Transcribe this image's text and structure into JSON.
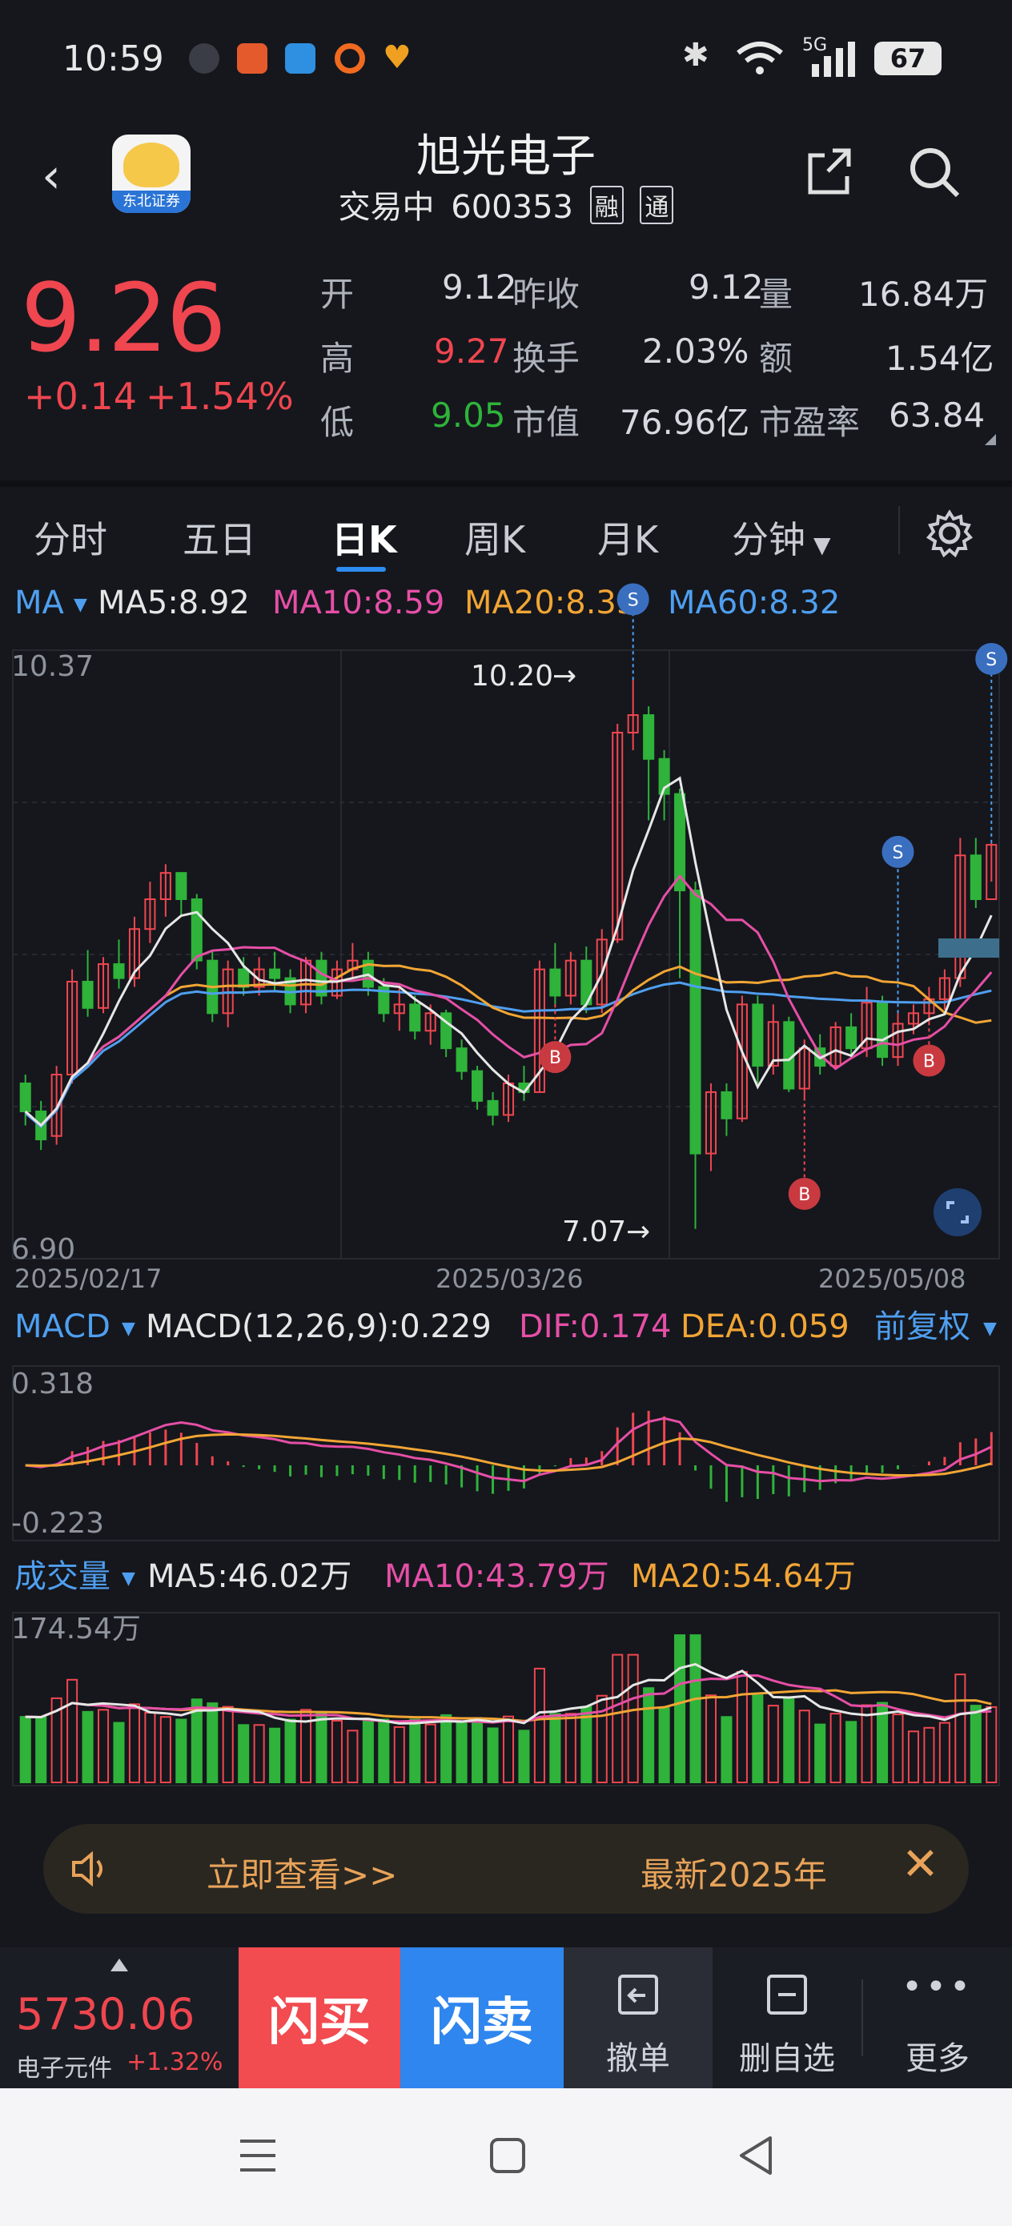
{
  "status_bar": {
    "time": "10:59",
    "battery": "67",
    "network": "5G"
  },
  "header": {
    "title": "旭光电子",
    "status": "交易中",
    "code": "600353",
    "tag_margin": "融",
    "tag_connect": "通",
    "logo_text": "东北证券"
  },
  "quote": {
    "price": "9.26",
    "change": "+0.14",
    "change_pct": "+1.54%",
    "open_label": "开",
    "open": "9.12",
    "prev_close_label": "昨收",
    "prev_close": "9.12",
    "volume_label": "量",
    "volume": "16.84万",
    "high_label": "高",
    "high": "9.27",
    "turnover_label": "换手",
    "turnover": "2.03%",
    "amount_label": "额",
    "amount": "1.54亿",
    "low_label": "低",
    "low": "9.05",
    "mktcap_label": "市值",
    "mktcap": "76.96亿",
    "pe_label": "市盈率",
    "pe": "63.84"
  },
  "tabs": [
    {
      "label": "分时"
    },
    {
      "label": "五日"
    },
    {
      "label": "日K"
    },
    {
      "label": "周K"
    },
    {
      "label": "月K"
    },
    {
      "label": "分钟"
    }
  ],
  "ma_legend": {
    "name": "MA",
    "ma5": "MA5:8.92",
    "ma10": "MA10:8.59",
    "ma20": "MA20:8.33",
    "ma60": "MA60:8.32"
  },
  "macd_legend": {
    "name": "MACD",
    "macd": "MACD(12,26,9):0.229",
    "dif": "DIF:0.174",
    "dea": "DEA:0.059",
    "adjust": "前复权"
  },
  "vol_legend": {
    "name": "成交量",
    "ma5": "MA5:46.02万",
    "ma10": "MA10:43.79万",
    "ma20": "MA20:54.64万"
  },
  "colors": {
    "up": "#f0464f",
    "down": "#2fb33a",
    "ma5": "#e6e6e6",
    "ma10": "#e64fa6",
    "ma20": "#f2a534",
    "ma60": "#4f9ff0",
    "accent": "#2d8cf0"
  },
  "chart_data": [
    {
      "type": "candlestick",
      "title": "",
      "x_labels": [
        "2025/02/17",
        "2025/03/26",
        "2025/05/08"
      ],
      "ylim": [
        6.9,
        10.37
      ],
      "y_labels": [
        "10.37",
        "6.90"
      ],
      "annotations": [
        {
          "label": "10.20",
          "kind": "high"
        },
        {
          "label": "7.07",
          "kind": "low"
        }
      ],
      "markers": [
        {
          "label": "S"
        },
        {
          "label": "S"
        },
        {
          "label": "S"
        },
        {
          "label": "B"
        },
        {
          "label": "B"
        },
        {
          "label": "B"
        }
      ],
      "candles": [
        [
          7.9,
          7.74,
          7.95,
          7.66
        ],
        [
          7.74,
          7.58,
          7.8,
          7.52
        ],
        [
          7.6,
          7.95,
          8.0,
          7.55
        ],
        [
          7.95,
          8.48,
          8.55,
          7.9
        ],
        [
          8.48,
          8.33,
          8.66,
          8.28
        ],
        [
          8.33,
          8.58,
          8.62,
          8.3
        ],
        [
          8.58,
          8.5,
          8.72,
          8.44
        ],
        [
          8.5,
          8.78,
          8.85,
          8.45
        ],
        [
          8.78,
          8.95,
          9.05,
          8.7
        ],
        [
          8.95,
          9.1,
          9.15,
          8.85
        ],
        [
          9.1,
          8.95,
          9.1,
          8.85
        ],
        [
          8.95,
          8.6,
          8.98,
          8.55
        ],
        [
          8.6,
          8.3,
          8.65,
          8.25
        ],
        [
          8.3,
          8.55,
          8.6,
          8.22
        ],
        [
          8.55,
          8.45,
          8.62,
          8.4
        ],
        [
          8.45,
          8.55,
          8.62,
          8.4
        ],
        [
          8.55,
          8.5,
          8.65,
          8.42
        ],
        [
          8.5,
          8.35,
          8.55,
          8.3
        ],
        [
          8.35,
          8.6,
          8.62,
          8.3
        ],
        [
          8.6,
          8.4,
          8.65,
          8.35
        ],
        [
          8.4,
          8.55,
          8.6,
          8.38
        ],
        [
          8.55,
          8.6,
          8.7,
          8.5
        ],
        [
          8.6,
          8.45,
          8.65,
          8.4
        ],
        [
          8.45,
          8.3,
          8.5,
          8.25
        ],
        [
          8.3,
          8.35,
          8.45,
          8.2
        ],
        [
          8.35,
          8.2,
          8.4,
          8.15
        ],
        [
          8.2,
          8.3,
          8.35,
          8.12
        ],
        [
          8.3,
          8.1,
          8.32,
          8.05
        ],
        [
          8.1,
          7.97,
          8.15,
          7.92
        ],
        [
          7.97,
          7.8,
          8.0,
          7.75
        ],
        [
          7.8,
          7.72,
          7.85,
          7.66
        ],
        [
          7.72,
          7.9,
          7.95,
          7.68
        ],
        [
          7.9,
          7.85,
          8.0,
          7.8
        ],
        [
          7.85,
          8.55,
          8.6,
          7.85
        ],
        [
          8.55,
          8.4,
          8.7,
          8.35
        ],
        [
          8.4,
          8.6,
          8.65,
          8.35
        ],
        [
          8.6,
          8.35,
          8.68,
          8.3
        ],
        [
          8.35,
          8.72,
          8.78,
          8.3
        ],
        [
          8.72,
          9.9,
          9.95,
          8.7
        ],
        [
          9.9,
          10.0,
          10.2,
          9.8
        ],
        [
          10.0,
          9.75,
          10.05,
          9.4
        ],
        [
          9.75,
          9.55,
          9.8,
          9.4
        ],
        [
          9.55,
          9.0,
          9.58,
          8.5
        ],
        [
          9.0,
          7.5,
          9.05,
          7.07
        ],
        [
          7.5,
          7.85,
          7.9,
          7.4
        ],
        [
          7.85,
          7.7,
          7.9,
          7.6
        ],
        [
          7.7,
          8.35,
          8.4,
          7.68
        ],
        [
          8.35,
          8.0,
          8.4,
          7.9
        ],
        [
          8.0,
          8.25,
          8.35,
          7.95
        ],
        [
          8.25,
          7.87,
          8.28,
          7.85
        ],
        [
          7.87,
          8.1,
          8.15,
          7.82
        ],
        [
          8.1,
          8.0,
          8.18,
          7.95
        ],
        [
          8.0,
          8.22,
          8.25,
          7.98
        ],
        [
          8.22,
          8.1,
          8.3,
          8.05
        ],
        [
          8.1,
          8.36,
          8.45,
          8.05
        ],
        [
          8.36,
          8.05,
          8.4,
          8.0
        ],
        [
          8.05,
          8.24,
          8.3,
          8.0
        ],
        [
          8.24,
          8.3,
          8.35,
          8.18
        ],
        [
          8.3,
          8.38,
          8.45,
          8.25
        ],
        [
          8.38,
          8.5,
          8.55,
          8.32
        ],
        [
          8.5,
          9.2,
          9.3,
          8.45
        ],
        [
          9.2,
          8.95,
          9.3,
          8.9
        ],
        [
          8.95,
          9.26,
          9.27,
          9.05
        ]
      ]
    }
  ]
}
